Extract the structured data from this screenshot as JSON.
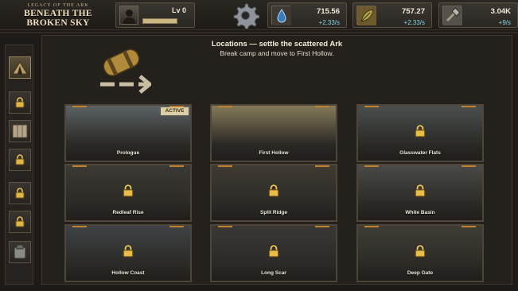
{
  "game": {
    "title_top": "LEGACY OF THE ARK",
    "title_main": "BENEATH THE BROKEN SKY"
  },
  "player": {
    "level_label": "Lv 0",
    "avatar_icon": "hooded-figure-icon"
  },
  "settings": {
    "icon": "gear-icon"
  },
  "resources": [
    {
      "name": "water",
      "icon": "water-drop-icon",
      "value": "715.56",
      "rate": "+2.33/s"
    },
    {
      "name": "plant",
      "icon": "leaf-icon",
      "value": "757.27",
      "rate": "+2.33/s"
    },
    {
      "name": "tools",
      "icon": "hammer-icon",
      "value": "3.04K",
      "rate": "+9/s"
    }
  ],
  "sidebar": [
    {
      "icon": "tent-icon",
      "state": "active"
    },
    {
      "icon": "lock-icon",
      "state": "locked"
    },
    {
      "icon": "map-icon",
      "state": "available"
    },
    {
      "icon": "lock-icon",
      "state": "locked"
    },
    {
      "icon": "lock-icon",
      "state": "locked"
    },
    {
      "icon": "lock-icon",
      "state": "locked"
    },
    {
      "icon": "pack-icon",
      "state": "available"
    }
  ],
  "main": {
    "heading": "Locations — settle the scattered Ark",
    "subheading": "Break camp and move to First Hollow.",
    "scroll_icon": "bedroll-arrow-icon"
  },
  "locations": [
    {
      "name": "Prologue",
      "locked": false,
      "badge": "ACTIVE",
      "tint": "#5c6264"
    },
    {
      "name": "First Hollow",
      "locked": false,
      "badge": "",
      "tint": "#857a58"
    },
    {
      "name": "Glasswater Flats",
      "locked": true,
      "badge": "",
      "tint": "#4a4f4d"
    },
    {
      "name": "Redleaf Rise",
      "locked": true,
      "badge": "",
      "tint": "#3b3a34"
    },
    {
      "name": "Split Ridge",
      "locked": true,
      "badge": "",
      "tint": "#3f3b32"
    },
    {
      "name": "White Basin",
      "locked": true,
      "badge": "",
      "tint": "#4a4a46"
    },
    {
      "name": "Hollow Coast",
      "locked": true,
      "badge": "",
      "tint": "#3f4346"
    },
    {
      "name": "Long Scar",
      "locked": true,
      "badge": "",
      "tint": "#3a3834"
    },
    {
      "name": "Deep Gate",
      "locked": true,
      "badge": "",
      "tint": "#3e3e36"
    }
  ]
}
